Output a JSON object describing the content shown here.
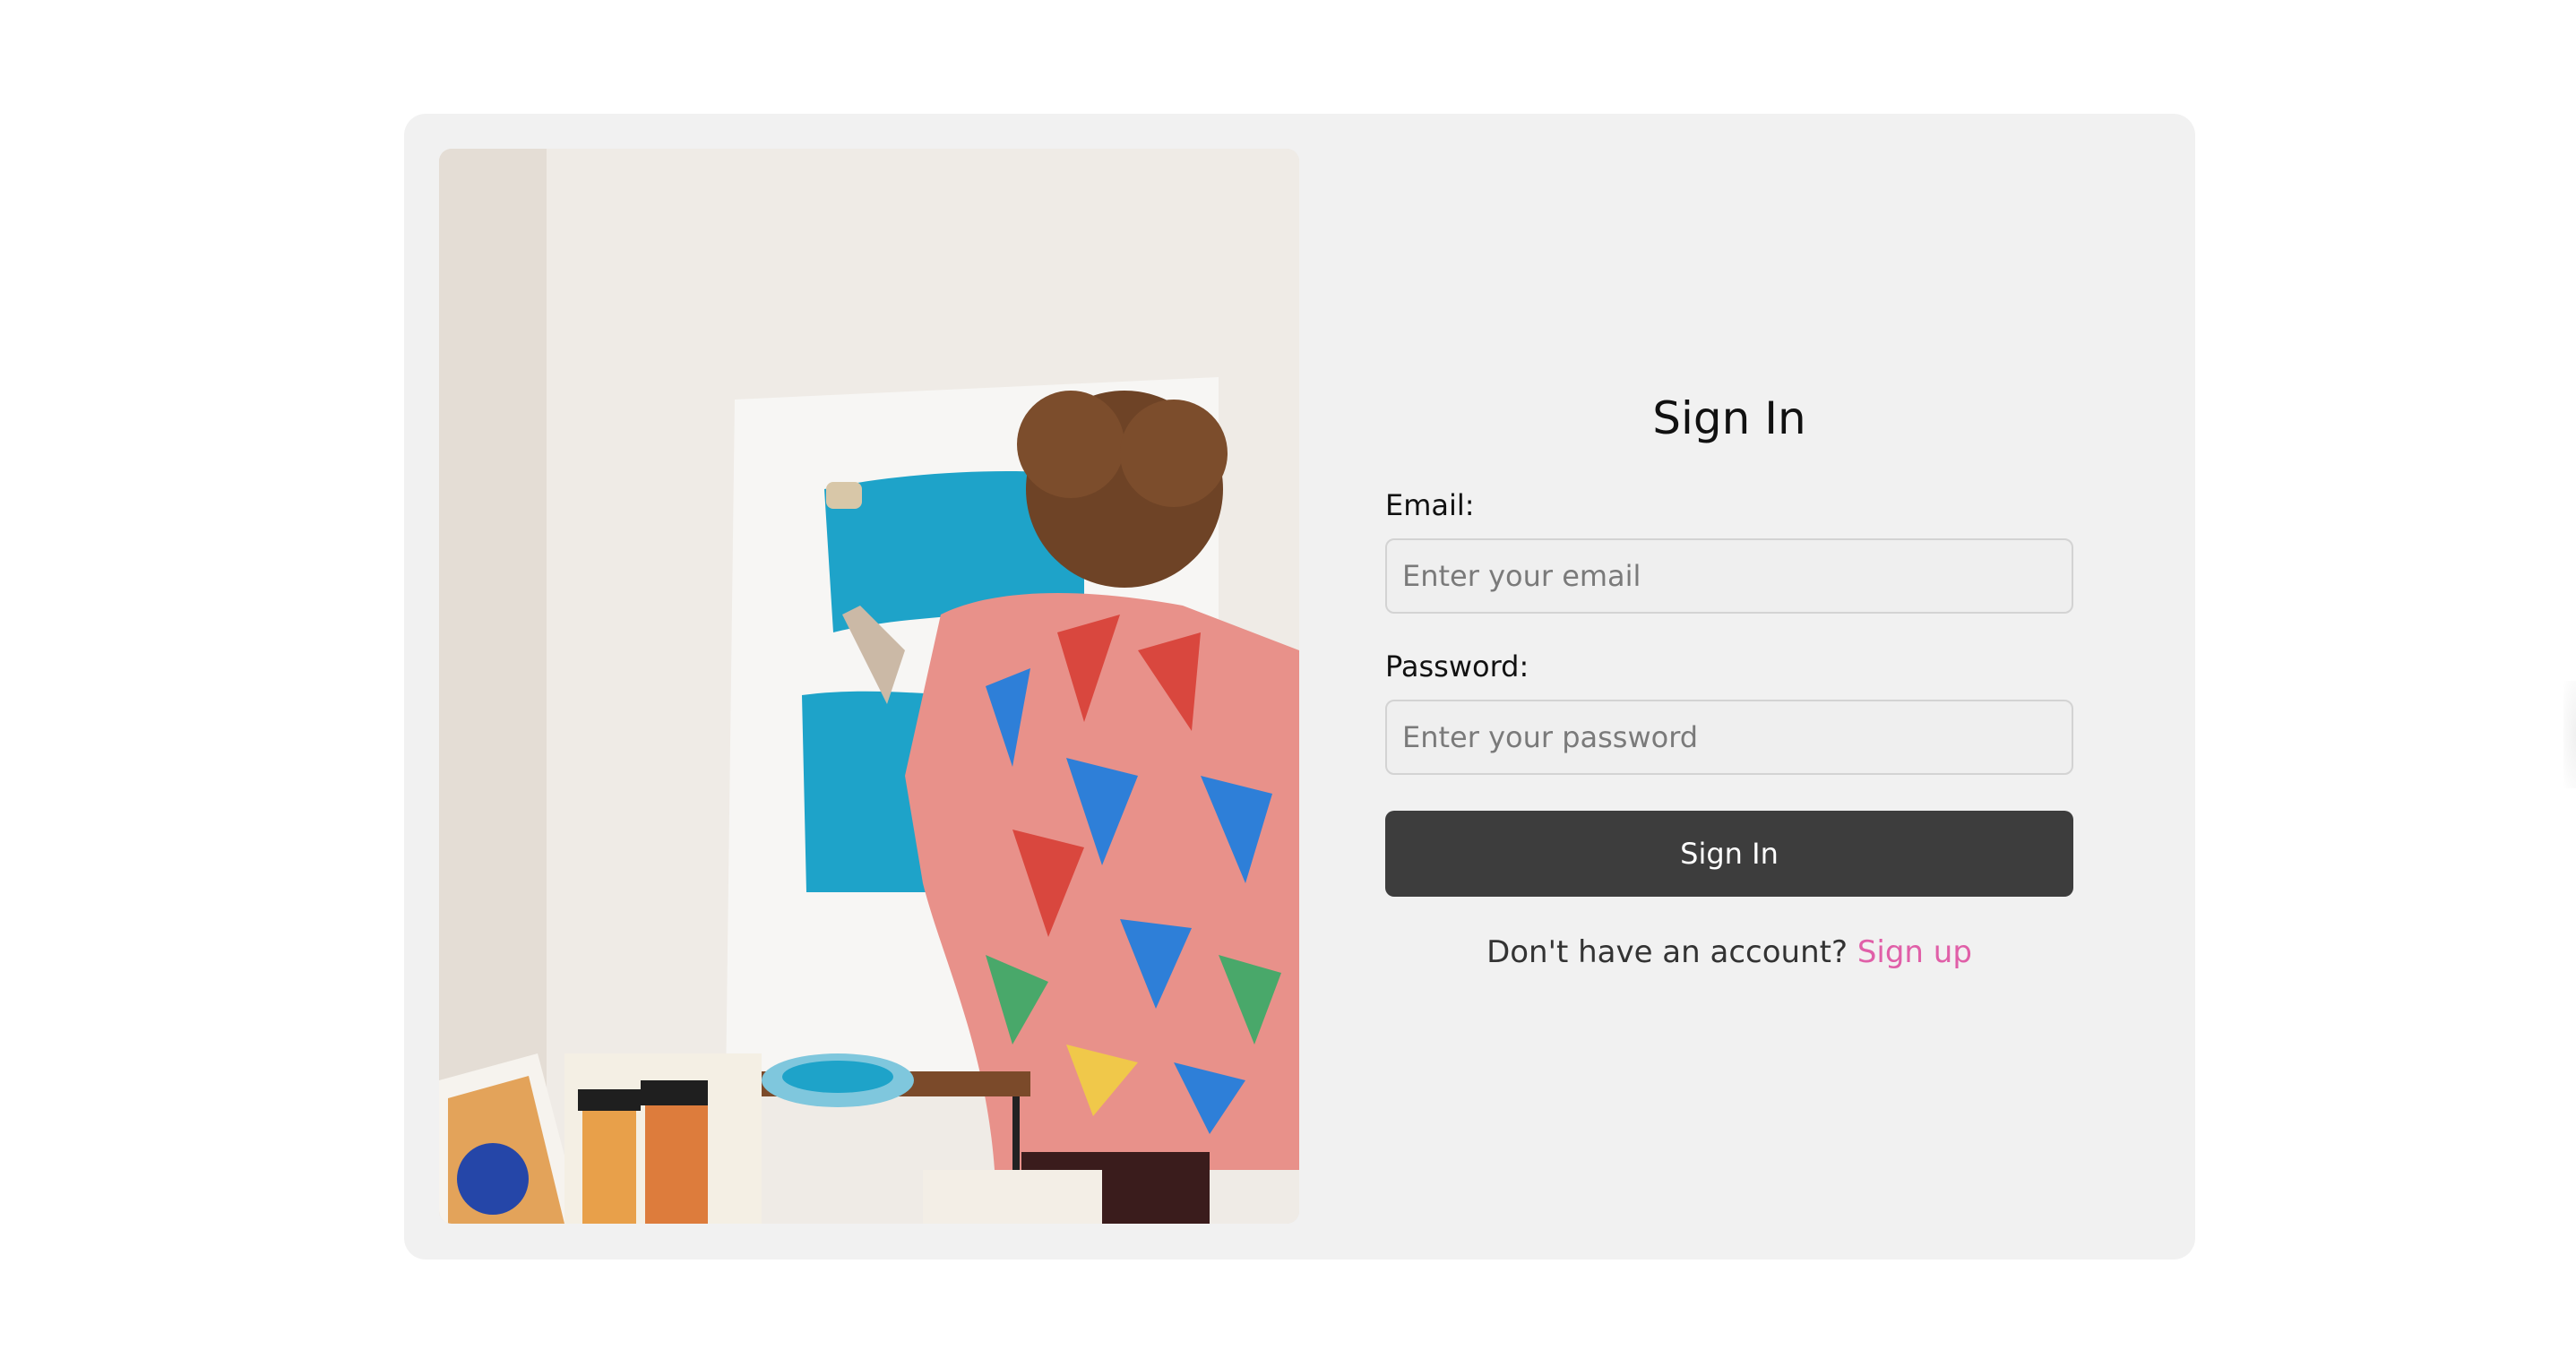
{
  "login": {
    "title": "Sign In",
    "email_label": "Email:",
    "email_placeholder": "Enter your email",
    "password_label": "Password:",
    "password_placeholder": "Enter your password",
    "submit_label": "Sign In",
    "signup_prompt": "Don't have an account?",
    "signup_link": "Sign up"
  },
  "colors": {
    "card_background": "#f1f1f1",
    "button_background": "#3d3d3d",
    "link_accent": "#e05fa8"
  },
  "photo": {
    "subject": "artist-painting-canvas-image"
  }
}
